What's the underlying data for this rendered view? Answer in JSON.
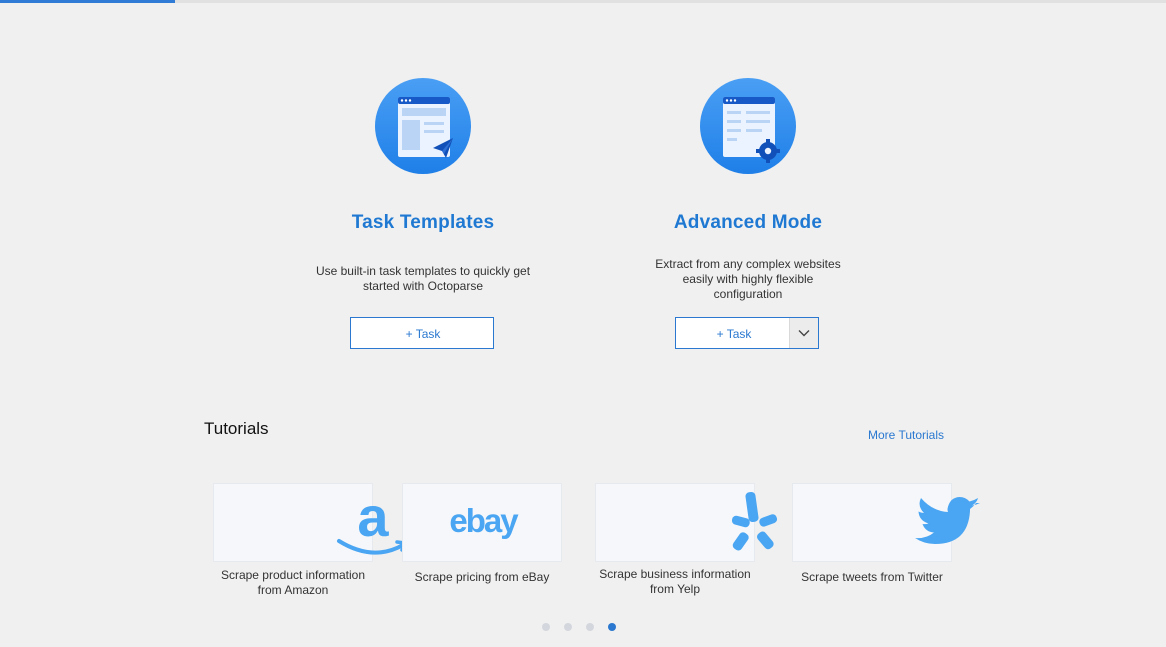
{
  "modes": {
    "templates": {
      "title": "Task Templates",
      "description": "Use built-in task templates to quickly get started with Octoparse",
      "button_label": "+ Task",
      "icon": "task-templates-icon"
    },
    "advanced": {
      "title": "Advanced Mode",
      "description": "Extract from any complex websites easily with highly flexible configuration",
      "button_label": "+ Task",
      "icon": "advanced-mode-icon"
    }
  },
  "tutorials": {
    "title": "Tutorials",
    "more_label": "More Tutorials",
    "items": [
      {
        "caption": "Scrape product information from Amazon",
        "logo": "amazon-logo"
      },
      {
        "caption": "Scrape pricing from eBay",
        "logo": "ebay-logo",
        "logo_text": "ebay"
      },
      {
        "caption": "Scrape business information from Yelp",
        "logo": "yelp-logo"
      },
      {
        "caption": "Scrape tweets from Twitter",
        "logo": "twitter-logo"
      }
    ],
    "carousel": {
      "page_count": 4,
      "active_index": 3
    }
  },
  "colors": {
    "accent": "#2a78d0",
    "title_blue": "#1f79d2",
    "logo_blue": "#4aa5f2",
    "background": "#f0f0f0"
  }
}
